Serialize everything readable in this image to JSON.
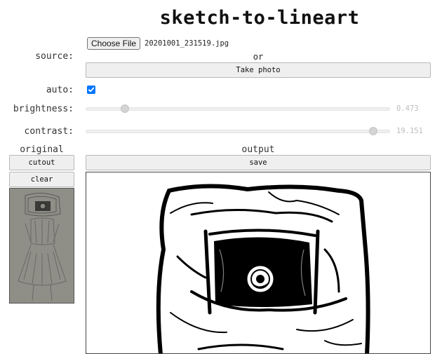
{
  "app": {
    "title": "sketch-to-lineart"
  },
  "source": {
    "label": "source:",
    "choose_file_label": "Choose File",
    "file_name": "20201001_231519.jpg",
    "or_text": "or",
    "take_photo_label": "Take photo"
  },
  "auto": {
    "label": "auto:",
    "checked": true
  },
  "brightness": {
    "label": "brightness:",
    "value": "0.473",
    "min": 0,
    "max": 4,
    "fraction": 0.118
  },
  "contrast": {
    "label": "contrast:",
    "value": "19.151",
    "min": 0,
    "max": 20,
    "fraction": 0.958
  },
  "original": {
    "heading": "original",
    "cutout_label": "cutout",
    "clear_label": "clear"
  },
  "output": {
    "heading": "output",
    "save_label": "save"
  },
  "colors": {
    "checkbox": "#0075ff",
    "slider_track": "#efefef",
    "value_text": "#bdbdbd"
  }
}
